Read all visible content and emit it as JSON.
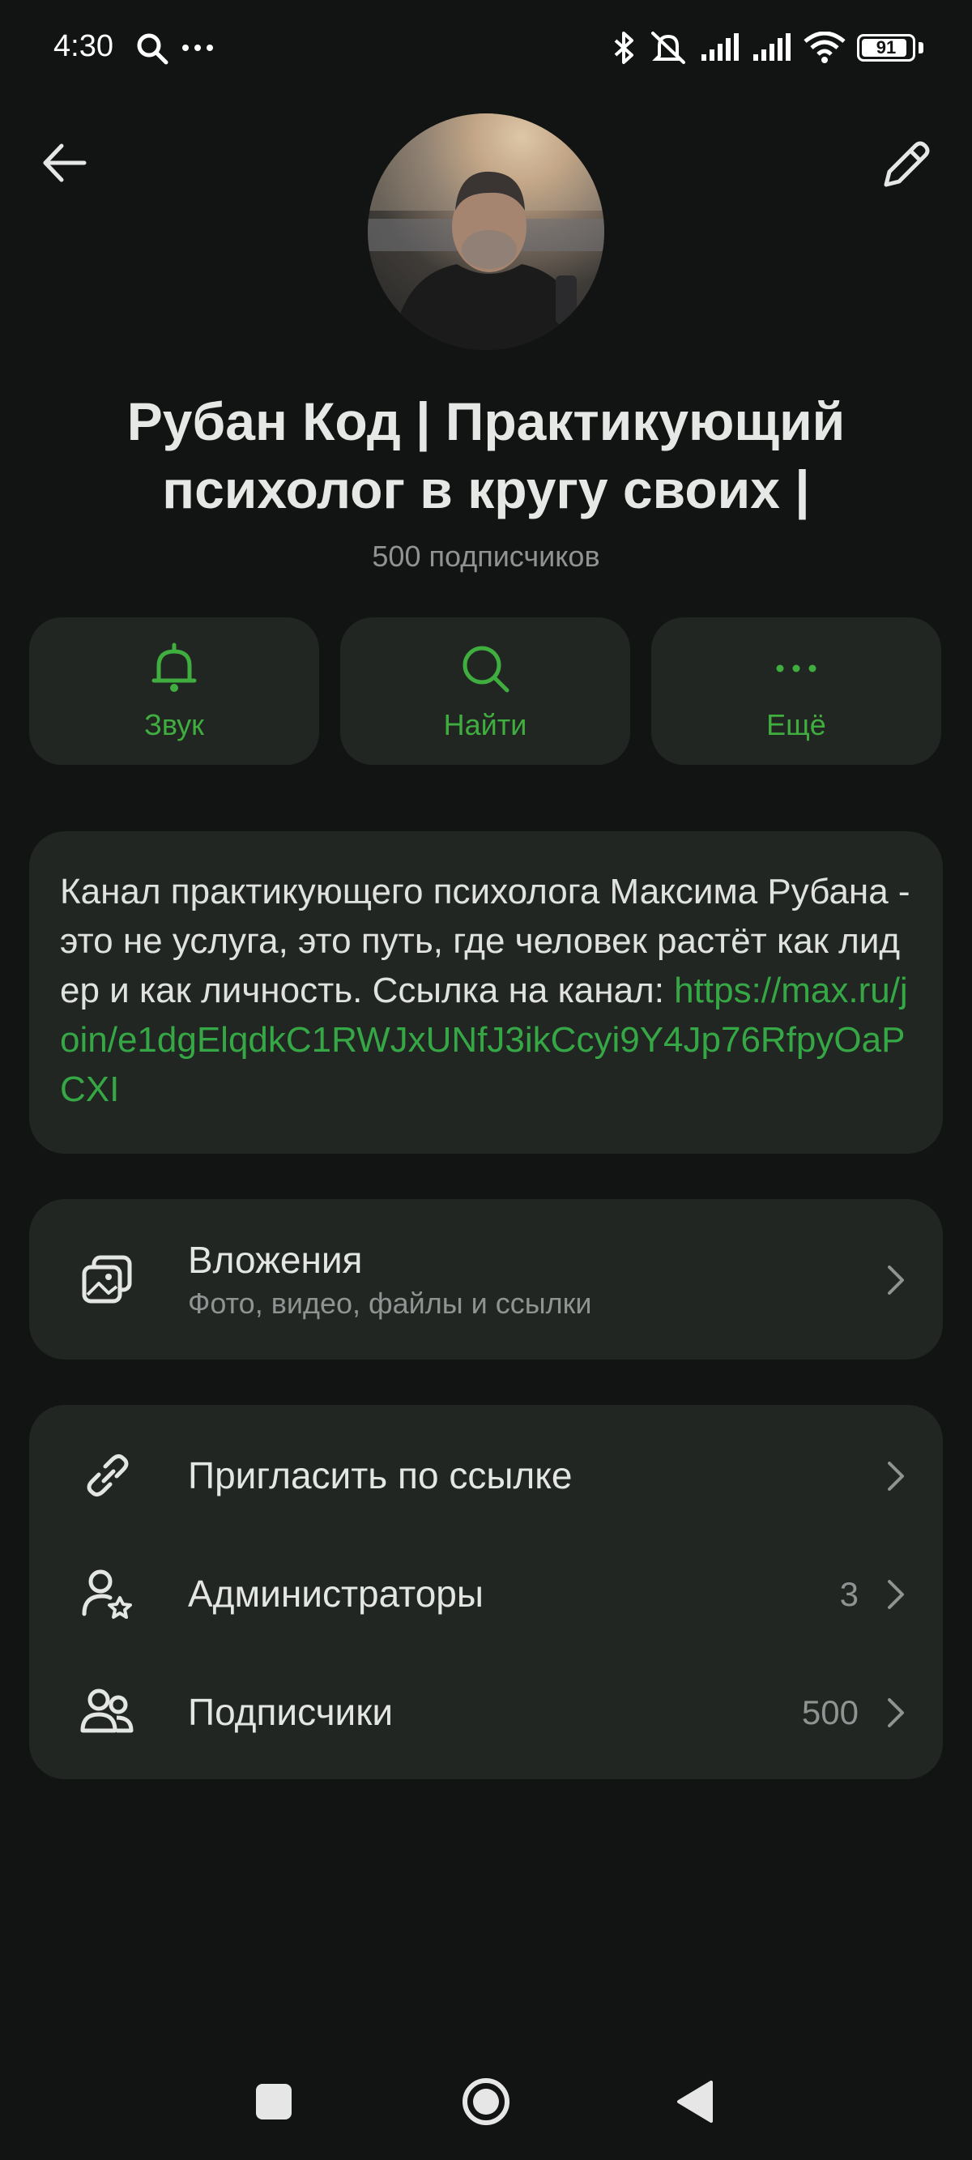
{
  "status_bar": {
    "time": "4:30",
    "battery": "91",
    "battery_level": 0.91,
    "icons": [
      "search-icon",
      "more-icon",
      "bluetooth-icon",
      "mute-icon",
      "signal-icon",
      "signal-icon",
      "wifi-icon",
      "battery-icon"
    ]
  },
  "header": {
    "title": "Рубан Код | Практикующий психолог в кругу своих |",
    "subscribers": "500 подписчиков"
  },
  "actions": [
    {
      "label": "Звук",
      "icon": "bell-icon"
    },
    {
      "label": "Найти",
      "icon": "search-icon"
    },
    {
      "label": "Ещё",
      "icon": "more-icon"
    }
  ],
  "description": {
    "text": "Канал практикующего психолога Максима Рубана -  это не услуга, это путь, где человек растёт как лидер и как личность. Ссылка на канал: ",
    "link": "https://max.ru/join/e1dgElqdkC1RWJxUNfJ3ikCcyi9Y4Jp76RfpyOaPCXI"
  },
  "attachments": {
    "title": "Вложения",
    "subtitle": "Фото, видео, файлы и ссылки"
  },
  "settings": [
    {
      "label": "Пригласить по ссылке",
      "count": ""
    },
    {
      "label": "Администраторы",
      "count": "3"
    },
    {
      "label": "Подписчики",
      "count": "500"
    }
  ],
  "colors": {
    "accent": "#3fae3f",
    "background": "#121413",
    "card": "#222623"
  }
}
